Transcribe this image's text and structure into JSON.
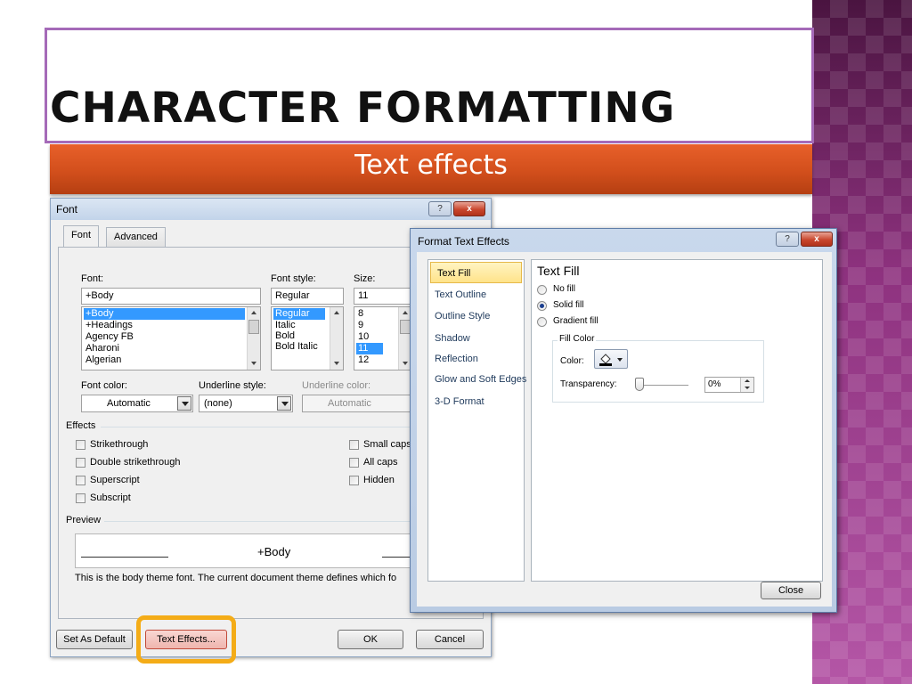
{
  "slide": {
    "title": "CHARACTER FORMATTING",
    "subtitle": "Text effects"
  },
  "font_dialog": {
    "title": "Font",
    "help_button": "?",
    "close_button": "x",
    "tabs": [
      "Font",
      "Advanced"
    ],
    "font_label": "Font:",
    "font_style_label": "Font style:",
    "size_label": "Size:",
    "font_value": "+Body",
    "font_style_value": "Regular",
    "size_value": "11",
    "font_list": [
      "+Body",
      "+Headings",
      "Agency FB",
      "Aharoni",
      "Algerian"
    ],
    "style_list": [
      "Regular",
      "Italic",
      "Bold",
      "Bold Italic"
    ],
    "size_list": [
      "8",
      "9",
      "10",
      "11",
      "12"
    ],
    "font_color_label": "Font color:",
    "font_color_value": "Automatic",
    "underline_style_label": "Underline style:",
    "underline_style_value": "(none)",
    "underline_color_label": "Underline color:",
    "underline_color_value": "Automatic",
    "effects_label": "Effects",
    "effects_left": [
      "Strikethrough",
      "Double strikethrough",
      "Superscript",
      "Subscript"
    ],
    "effects_right": [
      "Small caps",
      "All caps",
      "Hidden"
    ],
    "preview_label": "Preview",
    "preview_text": "+Body",
    "preview_note": "This is the body theme font. The current document theme defines which fo",
    "set_default_button": "Set As Default",
    "text_effects_button": "Text Effects...",
    "ok_button": "OK",
    "cancel_button": "Cancel"
  },
  "text_effects_dialog": {
    "title": "Format Text Effects",
    "help_button": "?",
    "close_button": "x",
    "nav_items": [
      "Text Fill",
      "Text Outline",
      "Outline Style",
      "Shadow",
      "Reflection",
      "Glow and Soft Edges",
      "3-D Format"
    ],
    "active_nav": "Text Fill",
    "panel_title": "Text Fill",
    "fill_options": [
      "No fill",
      "Solid fill",
      "Gradient fill"
    ],
    "selected_fill": "Solid fill",
    "fill_color_group": "Fill Color",
    "color_label": "Color:",
    "transparency_label": "Transparency:",
    "transparency_value": "0%",
    "close_label": "Close"
  }
}
